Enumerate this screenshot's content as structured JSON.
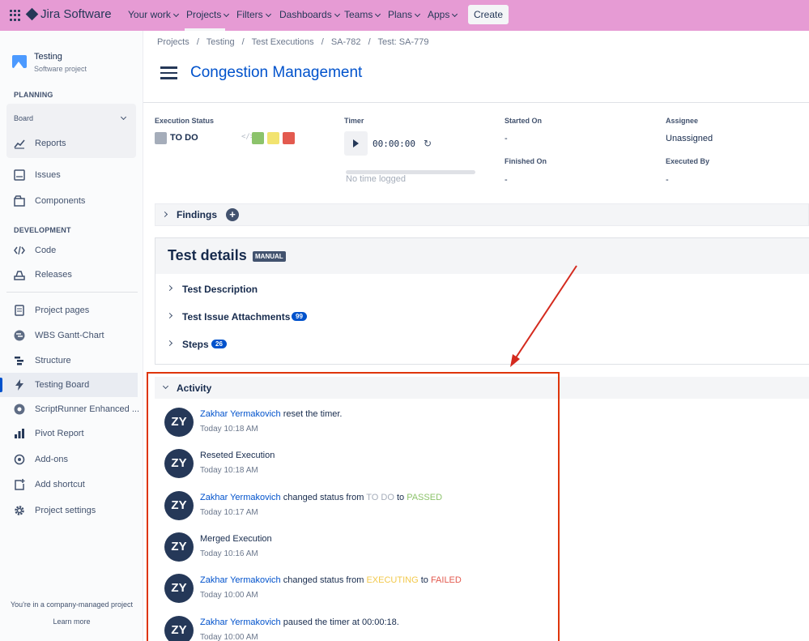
{
  "topbar": {
    "logo_text": "Jira Software",
    "nav": [
      "Your work",
      "Projects",
      "Filters",
      "Dashboards",
      "Teams",
      "Plans",
      "Apps"
    ],
    "create_label": "Create"
  },
  "sidebar": {
    "project_name": "Testing",
    "project_type": "Software project",
    "planning_title": "PLANNING",
    "board_label": "Board",
    "reports_label": "Reports",
    "issues_label": "Issues",
    "components_label": "Components",
    "development_title": "DEVELOPMENT",
    "code_label": "Code",
    "releases_label": "Releases",
    "project_pages_label": "Project pages",
    "wbs_label": "WBS Gantt-Chart",
    "structure_label": "Structure",
    "testing_board_label": "Testing Board",
    "scriptrunner_label": "ScriptRunner Enhanced ...",
    "pivot_label": "Pivot Report",
    "addons_label": "Add-ons",
    "add_shortcut_label": "Add shortcut",
    "settings_label": "Project settings",
    "footer_text": "You're in a company-managed project",
    "learn_more": "Learn more"
  },
  "breadcrumb": [
    "Projects",
    "/",
    "Testing",
    "/",
    "Test Executions",
    "/",
    "SA-782",
    "/",
    "Test: SA-779"
  ],
  "page_title": "Congestion Management",
  "execution": {
    "status_label": "Execution Status",
    "status_value": "TO DO",
    "code_glyph": "</>",
    "status_colors": [
      "#8cc36b",
      "#f2e36f",
      "#e35a4f"
    ],
    "timer_label": "Timer",
    "timer_value": "00:00:00",
    "no_time": "No time logged",
    "started_label": "Started On",
    "started_value": "-",
    "finished_label": "Finished On",
    "finished_value": "-",
    "assignee_label": "Assignee",
    "assignee_value": "Unassigned",
    "executed_label": "Executed By",
    "executed_value": "-"
  },
  "findings_label": "Findings",
  "test_details": {
    "title": "Test details",
    "badge": "MANUAL",
    "description_label": "Test Description",
    "attachments_label": "Test Issue Attachments",
    "attachments_count": "99",
    "steps_label": "Steps",
    "steps_count": "26"
  },
  "activity": {
    "title": "Activity",
    "colors": {
      "todo": "#a5adba",
      "passed": "#8cc36b",
      "executing": "#f2c94c",
      "failed": "#e35a4f"
    },
    "items": [
      {
        "initials": "ZY",
        "user": "Zakhar Yermakovich",
        "text": " reset the timer.",
        "time": "Today 10:18 AM"
      },
      {
        "initials": "ZY",
        "user": "",
        "text": "Reseted Execution",
        "time": "Today 10:18 AM"
      },
      {
        "initials": "ZY",
        "user": "Zakhar Yermakovich",
        "text": " changed status from ",
        "from": "TO DO",
        "to_word": " to ",
        "to": "PASSED",
        "time": "Today 10:17 AM"
      },
      {
        "initials": "ZY",
        "user": "",
        "text": "Merged Execution",
        "time": "Today 10:16 AM"
      },
      {
        "initials": "ZY",
        "user": "Zakhar Yermakovich",
        "text": " changed status from ",
        "from": "EXECUTING",
        "to_word": " to ",
        "to": "FAILED",
        "time": "Today 10:00 AM"
      },
      {
        "initials": "ZY",
        "user": "Zakhar Yermakovich",
        "text": " paused the timer at 00:00:18.",
        "time": "Today 10:00 AM"
      }
    ]
  }
}
